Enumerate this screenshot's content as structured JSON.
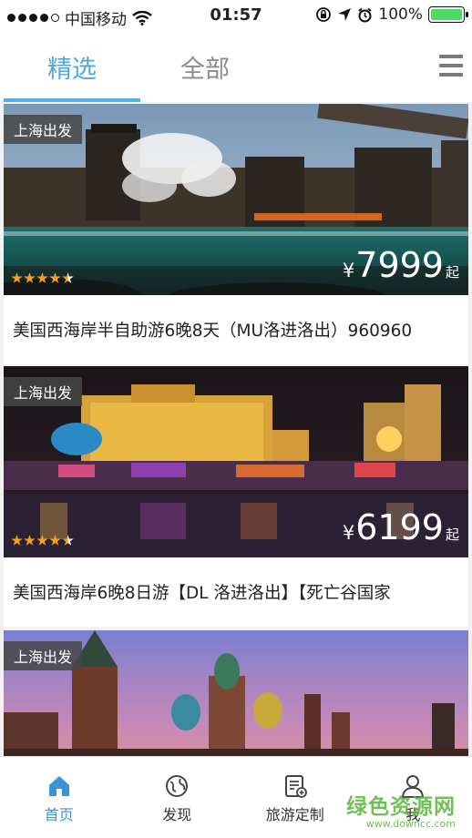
{
  "status_bar": {
    "carrier": "中国移动",
    "time": "01:57",
    "battery": "100%",
    "signal_dots_filled": 4,
    "signal_dots_total": 5
  },
  "tabs": [
    {
      "label": "精选",
      "active": true
    },
    {
      "label": "全部",
      "active": false
    }
  ],
  "menu_icon": "hamburger-menu-icon",
  "cards": [
    {
      "tag": "上海出发",
      "currency": "¥",
      "price": "7999",
      "price_unit": "起",
      "rating": 4.5,
      "title": "美国西海岸半自助游6晚8天（MU洛进洛出）960960"
    },
    {
      "tag": "上海出发",
      "currency": "¥",
      "price": "6199",
      "price_unit": "起",
      "rating": 4.5,
      "title": "美国西海岸6晚8日游【DL 洛进洛出】【死亡谷国家"
    },
    {
      "tag": "上海出发"
    }
  ],
  "bottom_nav": [
    {
      "label": "首页",
      "icon": "home-icon",
      "active": true
    },
    {
      "label": "发现",
      "icon": "globe-icon",
      "active": false
    },
    {
      "label": "旅游定制",
      "icon": "document-edit-icon",
      "active": false
    },
    {
      "label": "我",
      "icon": "user-icon",
      "active": false
    }
  ],
  "watermark": {
    "main": "绿色资源网",
    "sub": "www.downcc.com"
  },
  "colors": {
    "accent": "#4ea7e0",
    "tab_inactive": "#8b8b8b",
    "nav_active": "#3a93d6",
    "star": "#f4a020"
  }
}
